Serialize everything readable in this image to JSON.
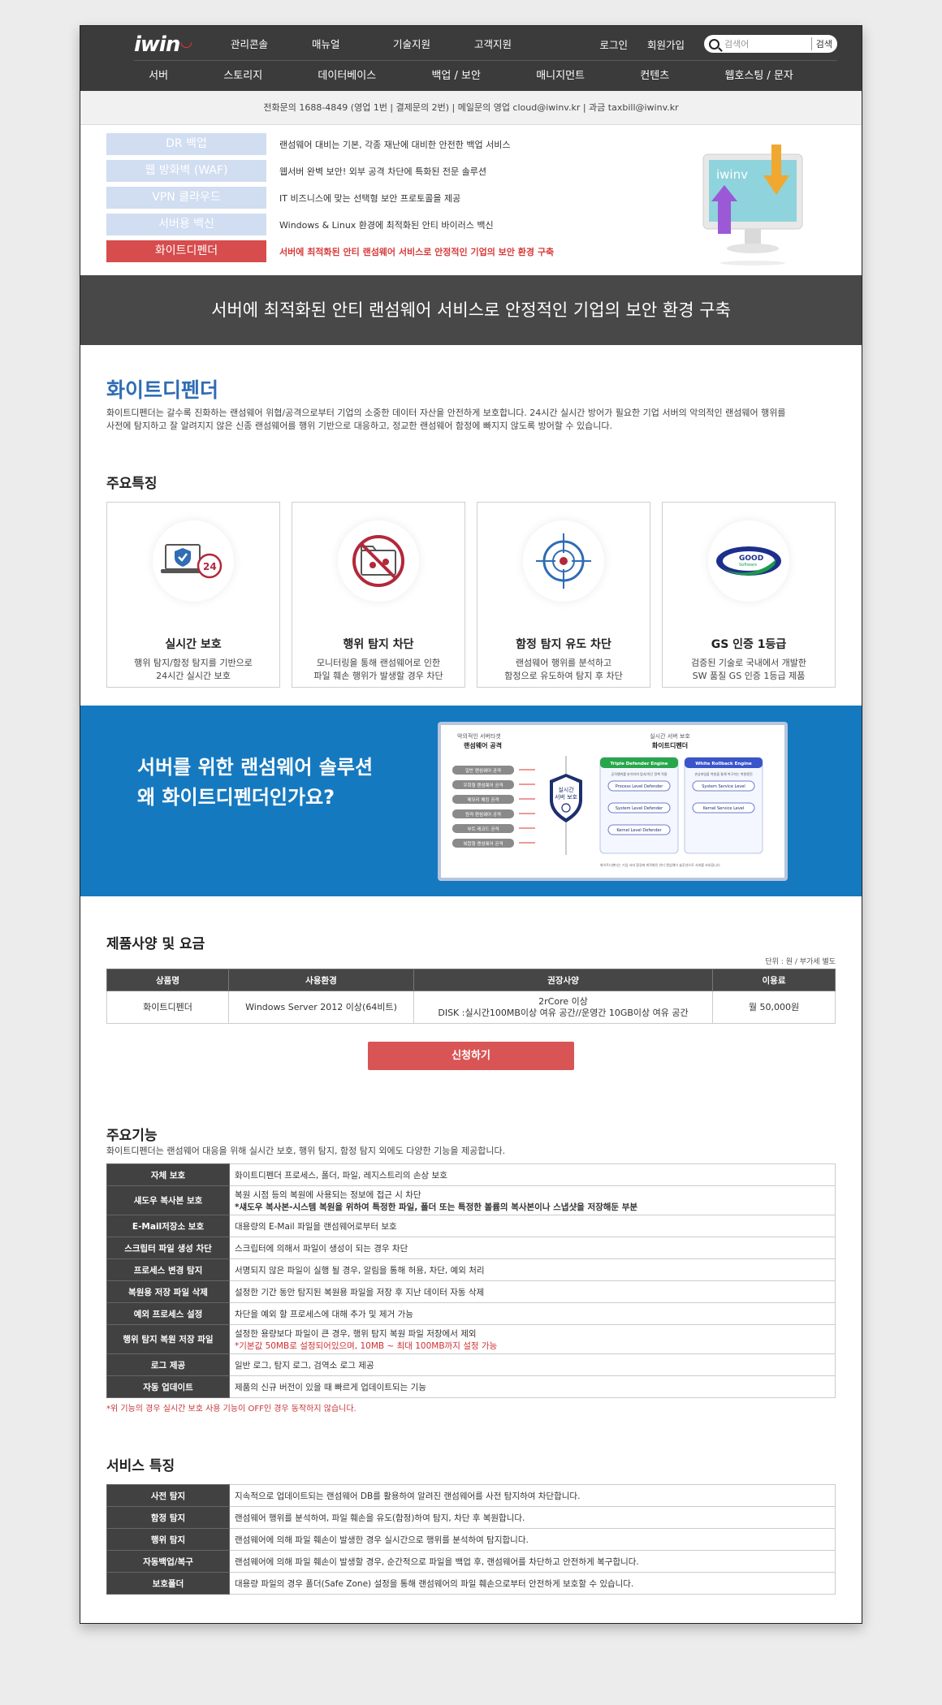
{
  "header": {
    "logo": "iwin",
    "top_menu": [
      "관리콘솔",
      "매뉴얼",
      "기술지원",
      "고객지원"
    ],
    "login": "로그인",
    "signup": "회원가입",
    "search_placeholder": "검색어",
    "search_button": "검색",
    "main_nav": [
      "서버",
      "스토리지",
      "데이터베이스",
      "백업 / 보안",
      "매니지먼트",
      "컨텐츠",
      "웹호스팅 / 문자"
    ]
  },
  "contact": "전화문의 1688-4849 (영업 1번 | 결제문의 2번) | 메일문의 영업 cloud@iwinv.kr | 과금 taxbill@iwinv.kr",
  "products": [
    {
      "name": "DR 백업",
      "desc": "랜섬웨어 대비는 기본, 각종 재난에 대비한 안전한 백업 서비스",
      "active": false
    },
    {
      "name": "웹 방화벽 (WAF)",
      "desc": "웹서버 완벽 보안! 외부 공격 차단에 특화된 전문 솔루션",
      "active": false
    },
    {
      "name": "VPN 클라우드",
      "desc": "IT 비즈니스에 맞는 선택형 보안 프로토콜을 제공",
      "active": false
    },
    {
      "name": "서버용 백신",
      "desc": "Windows & Linux 환경에 최적화된 안티 바이러스 백신",
      "active": false
    },
    {
      "name": "화이트디펜더",
      "desc": "서버에 최적화된 안티 랜섬웨어 서비스로 안정적인 기업의 보안 환경 구축",
      "active": true
    }
  ],
  "monitor_label": "iwinv",
  "banner": "서버에 최적화된 안티 랜섬웨어 서비스로 안정적인 기업의 보안 환경 구축",
  "intro": {
    "title": "화이트디펜더",
    "line1": "화이트디펜더는 갈수록 진화하는 랜섬웨어 위협/공격으로부터 기업의 소중한 데이터 자산을 안전하게 보호합니다. 24시간 실시간 방어가 필요한 기업 서버의 악의적인 랜섬웨어 행위를",
    "line2": "사전에 탐지하고 잘 알려지지 않은 신종 랜섬웨어를 행위 기반으로 대응하고, 정교한 랜섬웨어 함정에 빠지지 않도록 방어할 수 있습니다."
  },
  "features_title": "주요특징",
  "features": [
    {
      "icon": "laptop-shield-icon",
      "title": "실시간 보호",
      "d1": "행위 탐지/함정 탐지를 기반으로",
      "d2": "24시간 실시간 보호"
    },
    {
      "icon": "folder-block-icon",
      "title": "행위 탐지 차단",
      "d1": "모니터링을 통해 랜섬웨어로 인한",
      "d2": "파일 훼손 행위가 발생할 경우 차단"
    },
    {
      "icon": "target-icon",
      "title": "함정 탐지 유도 차단",
      "d1": "랜섬웨어 행위를 분석하고",
      "d2": "함정으로 유도하여 탐지 후 차단"
    },
    {
      "icon": "gs-certified-icon",
      "title": "GS 인증 1등급",
      "d1": "검증된 기술로 국내에서 개발한",
      "d2": "SW 품질 GS 인증 1등급 제품"
    }
  ],
  "gs_logo_text": "GOOD",
  "gs_logo_sub": "Software",
  "blue": {
    "line1": "서버를 위한 랜섬웨어 솔루션",
    "line2": "왜 화이트디펜더인가요?"
  },
  "diagram": {
    "left_caption": "악의적인 서버타겟",
    "left_title": "랜섬웨어 공격",
    "attacks": [
      "일반 랜섬웨어 공격",
      "우회형 랜섬웨어 공격",
      "메모리 해킹 공격",
      "원격 랜섬웨어 공격",
      "부트 레코드 공격",
      "복합형 랜섬웨어 공격"
    ],
    "shield_l1": "실시간",
    "shield_l2": "서버 보호",
    "right_caption": "실시간 서버 보호",
    "right_title": "화이트디펜더",
    "engine1": "Triple Defender Engine",
    "engine1_desc": "공격행위를 분석하여 탐지/차단 정책 적용",
    "engine1_levels": [
      "Process Level Defender",
      "System Level Defender",
      "Kernel Level Defender"
    ],
    "engine2": "White Rollback Engine",
    "engine2_desc": "손상파일을 복원을 통해 복구하는 복원엔진",
    "engine2_levels": [
      "System Service Level",
      "Kernel Service Level"
    ],
    "footer": "화이트디펜더는 기업 서버 환경에 최적화된 안티 랜섬웨어 솔루션으로 서버를 보호합니다."
  },
  "spec": {
    "title": "제품사양 및 요금",
    "unit": "단위 : 원 / 부가세 별도",
    "headers": [
      "상품명",
      "사용환경",
      "권장사양",
      "이용료"
    ],
    "row": {
      "name": "화이트디펜더",
      "env": "Windows Server 2012 이상(64비트)",
      "req1": "2rCore 이상",
      "req2": "DISK :실시간100MB이상 여유 공간//운영간 10GB이상 여유 공간",
      "fee": "월 50,000원"
    }
  },
  "apply_button": "신청하기",
  "functions": {
    "title": "주요기능",
    "subtitle": "화이트디펜더는 랜섬웨어 대응을 위해 실시간 보호, 행위 탐지, 함정 탐지 외에도 다양한 기능을 제공합니다.",
    "rows": [
      {
        "k": "자체 보호",
        "v": "화이트디펜더 프로세스, 폴더, 파일, 레지스트리의 손상 보호",
        "v2": "",
        "v2_red": false
      },
      {
        "k": "섀도우 복사본 보호",
        "v": "복원 시점 등의 복원에 사용되는 정보에 접근 시 차단",
        "v2": "*섀도우 복사본-시스템 복원을 위하여 특정한 파일, 폴더 또는 특정한 볼륨의 복사본이나 스냅샷을 저장해둔 부분",
        "v2_red": false
      },
      {
        "k": "E-Mail저장소 보호",
        "v": "대용량의 E-Mail 파일을 랜섬웨어로부터 보호",
        "v2": "",
        "v2_red": false
      },
      {
        "k": "스크립터 파일 생성 차단",
        "v": "스크립터에 의해서 파일이 생성이 되는 경우 차단",
        "v2": "",
        "v2_red": false
      },
      {
        "k": "프로세스 변경 탐지",
        "v": "서명되지 않은 파일이 실행 될 경우, 알림을 통해 허용, 차단, 예외 처리",
        "v2": "",
        "v2_red": false
      },
      {
        "k": "복원용 저장 파일 삭제",
        "v": "설정한 기간 동안 탐지된 복원용 파일을 저장 후 지난 데이터 자동 삭제",
        "v2": "",
        "v2_red": false
      },
      {
        "k": "예외 프로세스 설정",
        "v": "차단을 예외 할 프로세스에 대해 추가 및 제거 가능",
        "v2": "",
        "v2_red": false
      },
      {
        "k": "행위 탐지 복원 저장 파일",
        "v": "설정한 용량보다 파일이 큰 경우, 행위 탐지 복원 파일 저장에서 제외",
        "v2": "*기본값 50MB로 설정되어있으며, 10MB ~ 최대 100MB까지 설정 가능",
        "v2_red": true
      },
      {
        "k": "로그 제공",
        "v": "일반 로그, 탐지 로그, 검역소 로그 제공",
        "v2": "",
        "v2_red": false
      },
      {
        "k": "자동 업데이트",
        "v": "제품의 신규 버전이 있을 때 빠르게 업데이트되는 기능",
        "v2": "",
        "v2_red": false
      }
    ],
    "note": "*위 기능의 경우 실시간 보호 사용 기능이 OFF인 경우 동작하지 않습니다."
  },
  "service": {
    "title": "서비스 특징",
    "rows": [
      {
        "k": "사전 탐지",
        "v": "지속적으로 업데이트되는 랜섬웨어 DB를 활용하여 알려진 랜섬웨어를 사전 탐지하여 차단합니다."
      },
      {
        "k": "함정 탐지",
        "v": "랜섬웨어 행위를 분석하여, 파일 훼손을 유도(함정)하여 탐지, 차단 후 복원합니다."
      },
      {
        "k": "행위 탐지",
        "v": "랜섬웨어에 의해 파일 훼손이 발생한 경우 실시간으로 행위를 분석하여 탐지합니다."
      },
      {
        "k": "자동백업/복구",
        "v": "랜섬웨어에 의해 파일 훼손이 발생할 경우, 순간적으로 파일을 백업 후, 랜섬웨어를 차단하고 안전하게 복구합니다."
      },
      {
        "k": "보호폴더",
        "v": "대용량 파일의 경우 폴더(Safe Zone) 설정을 통해 랜섬웨어의 파일 훼손으로부터 안전하게 보호할 수 있습니다."
      }
    ]
  }
}
